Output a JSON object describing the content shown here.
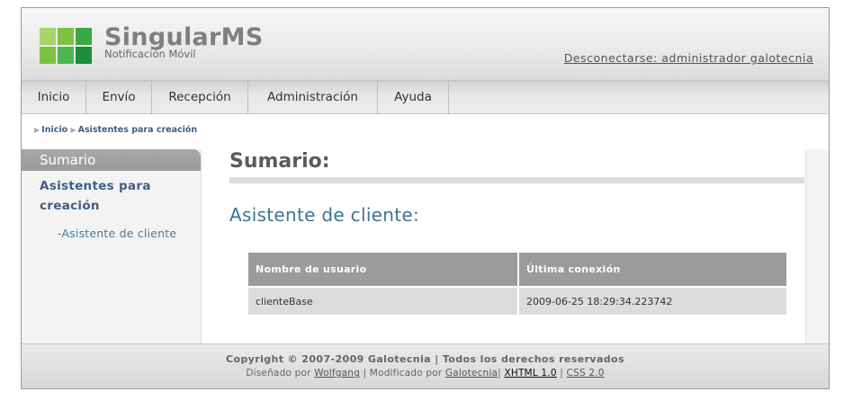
{
  "brand": {
    "name": "SingularMS",
    "tagline": "Notificación Móvil",
    "logo_colors": [
      "#a8d36a",
      "#7cc242",
      "#3aa845",
      "#7cc242",
      "#4fb552",
      "#1d8e3e"
    ]
  },
  "header": {
    "logout_label": "Desconectarse: administrador galotecnia"
  },
  "nav": {
    "items": [
      {
        "label": "Inicio"
      },
      {
        "label": "Envío"
      },
      {
        "label": "Recepción"
      },
      {
        "label": "Administración"
      },
      {
        "label": "Ayuda"
      }
    ]
  },
  "breadcrumb": {
    "items": [
      {
        "label": "Inicio"
      },
      {
        "label": "Asistentes para creación"
      }
    ]
  },
  "sidebar": {
    "title": "Sumario",
    "section_label": "Asistentes para creación",
    "sub_item_label": "-Asistente de cliente"
  },
  "main": {
    "title": "Sumario:",
    "subtitle": "Asistente de cliente:",
    "table": {
      "headers": [
        "Nombre de usuario",
        "Última conexión"
      ],
      "rows": [
        [
          "clienteBase",
          "2009-06-25 18:29:34.223742"
        ]
      ]
    }
  },
  "footer": {
    "copyright": "Copyright © 2007-2009 Galotecnia | Todos los derechos reservados",
    "designed_prefix": "Diseñado por",
    "designer_link": "Wolfgang",
    "modified_prefix": "| Modificado por",
    "modifier_link": "Galotecnia",
    "sep1": "|",
    "xhtml_link": "XHTML 1.0",
    "sep2": "|",
    "css_link": "CSS 2.0"
  },
  "colors": {
    "link": "#3e5f84",
    "heading_blue": "#3f7391",
    "table_header": "#9b9b9b"
  }
}
